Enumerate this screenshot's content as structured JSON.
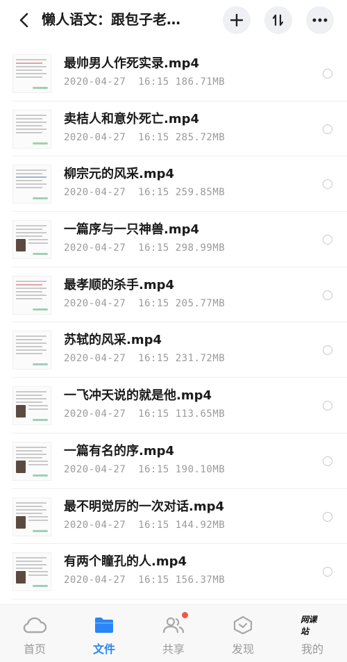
{
  "header": {
    "title": "懒人语文：跟包子老…",
    "sort_label": "⇅"
  },
  "files": [
    {
      "name": "最帅男人作死实录.mp4",
      "date": "2020-04-27",
      "time": "16:15",
      "size": "186.71MB"
    },
    {
      "name": "卖桔人和意外死亡.mp4",
      "date": "2020-04-27",
      "time": "16:15",
      "size": "285.72MB"
    },
    {
      "name": "柳宗元的风采.mp4",
      "date": "2020-04-27",
      "time": "16:15",
      "size": "259.85MB"
    },
    {
      "name": "一篇序与一只神兽.mp4",
      "date": "2020-04-27",
      "time": "16:15",
      "size": "298.99MB"
    },
    {
      "name": "最孝顺的杀手.mp4",
      "date": "2020-04-27",
      "time": "16:15",
      "size": "205.77MB"
    },
    {
      "name": "苏轼的风采.mp4",
      "date": "2020-04-27",
      "time": "16:15",
      "size": "231.72MB"
    },
    {
      "name": "一飞冲天说的就是他.mp4",
      "date": "2020-04-27",
      "time": "16:15",
      "size": "113.65MB"
    },
    {
      "name": "一篇有名的序.mp4",
      "date": "2020-04-27",
      "time": "16:15",
      "size": "190.10MB"
    },
    {
      "name": "最不明觉厉的一次对话.mp4",
      "date": "2020-04-27",
      "time": "16:15",
      "size": "144.92MB"
    },
    {
      "name": "有两个瞳孔的人.mp4",
      "date": "2020-04-27",
      "time": "16:15",
      "size": "156.37MB"
    }
  ],
  "nav": {
    "home": "首页",
    "files": "文件",
    "share": "共享",
    "discover": "发现",
    "mine": "我的",
    "brand_badge": "网课站"
  },
  "colors": {
    "accent": "#2a86f5",
    "badge": "#f2554d"
  }
}
